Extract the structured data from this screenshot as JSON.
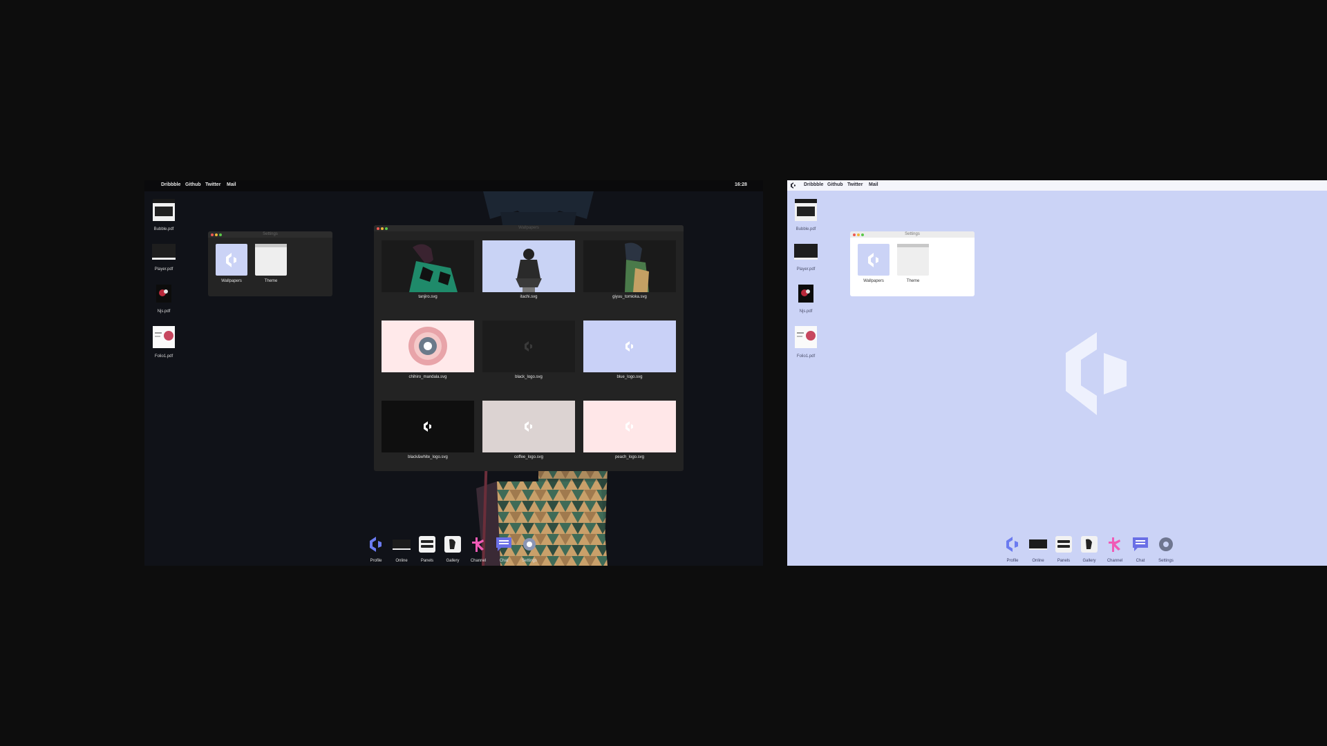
{
  "dark_desktop": {
    "menu": [
      "Dribbble",
      "Github",
      "Twitter",
      "Mail"
    ],
    "clock": "16:28",
    "desktop_icons": [
      {
        "label": "Bubble.pdf",
        "icon": "window-thumbnail-icon"
      },
      {
        "label": "Player.pdf",
        "icon": "monitor-thumbnail-icon"
      },
      {
        "label": "Njs.pdf",
        "icon": "dark-poster-thumbnail-icon"
      },
      {
        "label": "Folio1.pdf",
        "icon": "folio-thumbnail-icon"
      }
    ],
    "settings_window": {
      "title": "Settings",
      "items": [
        {
          "label": "Wallpapers",
          "icon": "wallpapers-icon"
        },
        {
          "label": "Theme",
          "icon": "theme-icon"
        }
      ]
    },
    "wallpapers_window": {
      "title": "Wallpapers",
      "items": [
        {
          "label": "tanjiro.svg",
          "bg": "#1a1a1a"
        },
        {
          "label": "itachi.svg",
          "bg": "#c9d3f5"
        },
        {
          "label": "giyuu_tomioka.svg",
          "bg": "#1a1a1a"
        },
        {
          "label": "chihiro_mandala.svg",
          "bg": "#ffe9ea"
        },
        {
          "label": "black_logo.svg",
          "bg": "#1c1c1c"
        },
        {
          "label": "blue_logo.svg",
          "bg": "#c9d1f7"
        },
        {
          "label": "black&white_logo.svg",
          "bg": "#0f0f0f"
        },
        {
          "label": "coffee_logo.svg",
          "bg": "#dcd3d2"
        },
        {
          "label": "peach_logo.svg",
          "bg": "#ffe7e8"
        }
      ]
    },
    "dock": [
      {
        "label": "Profile",
        "icon": "logo-icon"
      },
      {
        "label": "Online",
        "icon": "monitor-icon"
      },
      {
        "label": "Panels",
        "icon": "panels-icon"
      },
      {
        "label": "Gallery",
        "icon": "gallery-icon"
      },
      {
        "label": "Channel",
        "icon": "channel-icon"
      },
      {
        "label": "Chat",
        "icon": "chat-icon"
      },
      {
        "label": "Settings",
        "icon": "gear-icon"
      }
    ]
  },
  "light_desktop": {
    "menu": [
      "Dribbble",
      "Github",
      "Twitter",
      "Mail"
    ],
    "desktop_icons": [
      {
        "label": "Bubble.pdf",
        "icon": "window-thumbnail-icon"
      },
      {
        "label": "Player.pdf",
        "icon": "monitor-thumbnail-icon"
      },
      {
        "label": "Njs.pdf",
        "icon": "dark-poster-thumbnail-icon"
      },
      {
        "label": "Folio1.pdf",
        "icon": "folio-thumbnail-icon"
      }
    ],
    "settings_window": {
      "title": "Settings",
      "items": [
        {
          "label": "Wallpapers",
          "icon": "wallpapers-icon"
        },
        {
          "label": "Theme",
          "icon": "theme-icon"
        }
      ]
    },
    "dock": [
      {
        "label": "Profile",
        "icon": "logo-icon"
      },
      {
        "label": "Online",
        "icon": "monitor-icon"
      },
      {
        "label": "Panels",
        "icon": "panels-icon"
      },
      {
        "label": "Gallery",
        "icon": "gallery-icon"
      },
      {
        "label": "Channel",
        "icon": "channel-icon"
      },
      {
        "label": "Chat",
        "icon": "chat-icon"
      },
      {
        "label": "Settings",
        "icon": "gear-icon"
      }
    ]
  },
  "colors": {
    "accent_blue": "#6b7bf0",
    "channel_pink": "#f05bb6",
    "chat_purple": "#6a6fe6",
    "light_bg": "#cbd3f6",
    "dark_bg": "#101218"
  }
}
